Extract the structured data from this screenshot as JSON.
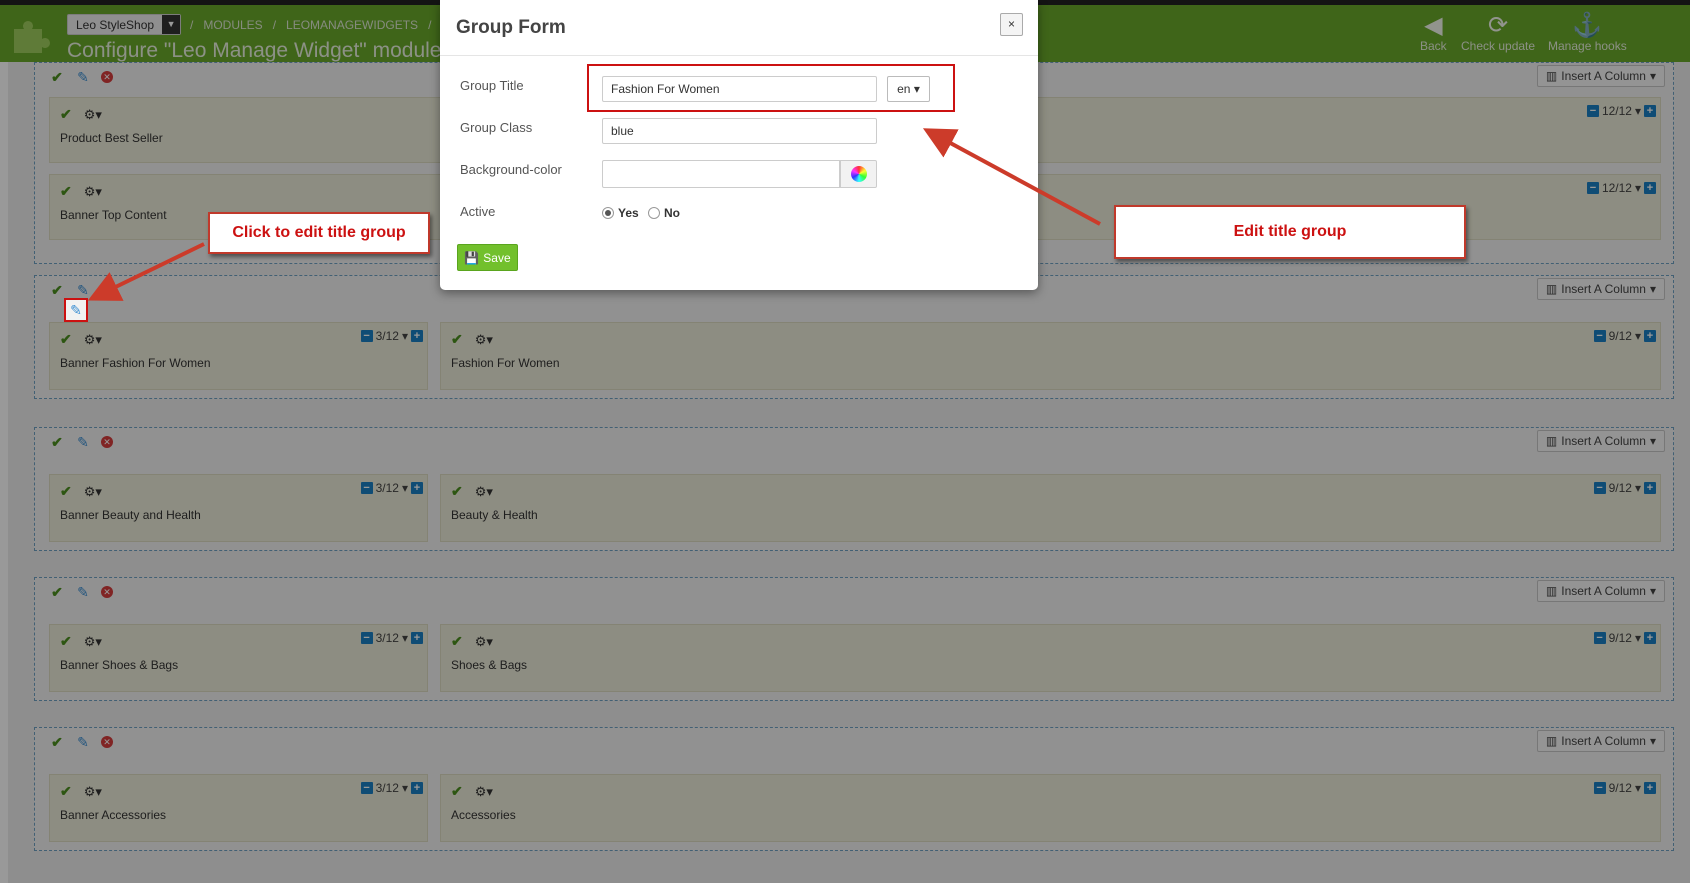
{
  "topbar": {
    "shop_name": "Leo StyleShop",
    "breadcrumb": [
      "MODULES",
      "LEOMANAGEWIDGETS"
    ],
    "breadcrumb_sep": "/",
    "title": "Configure \"Leo Manage Widget\" module",
    "buttons": [
      {
        "label": "Back",
        "icon": "back-icon"
      },
      {
        "label": "Check update",
        "icon": "refresh-icon"
      },
      {
        "label": "Manage hooks",
        "icon": "anchor-icon"
      }
    ]
  },
  "insert_column_label": "Insert A Column",
  "groups": [
    {
      "columns": [
        {
          "title": "Product Best Seller",
          "width": "12/12"
        }
      ]
    },
    {
      "columns": [
        {
          "title": "Banner Top Content",
          "width": "12/12"
        }
      ]
    },
    {
      "columns": [
        {
          "title": "Banner Fashion For Women",
          "width": "3/12"
        },
        {
          "title": "Fashion For Women",
          "width": "9/12"
        }
      ]
    },
    {
      "columns": [
        {
          "title": "Banner Beauty and Health",
          "width": "3/12"
        },
        {
          "title": "Beauty & Health",
          "width": "9/12"
        }
      ]
    },
    {
      "columns": [
        {
          "title": "Banner Shoes & Bags",
          "width": "3/12"
        },
        {
          "title": "Shoes & Bags",
          "width": "9/12"
        }
      ]
    },
    {
      "columns": [
        {
          "title": "Banner Accessories",
          "width": "3/12"
        },
        {
          "title": "Accessories",
          "width": "9/12"
        }
      ]
    }
  ],
  "modal": {
    "title": "Group Form",
    "close": "×",
    "group_title_label": "Group Title",
    "group_title_value": "Fashion For Women",
    "lang": "en",
    "group_class_label": "Group Class",
    "group_class_value": "blue",
    "bg_color_label": "Background-color",
    "bg_color_value": "",
    "active_label": "Active",
    "yes": "Yes",
    "no": "No",
    "active_selected": "Yes",
    "save": "Save"
  },
  "callouts": {
    "left": "Click to edit title group",
    "right": "Edit title group"
  },
  "colors": {
    "topbar": "#6aa82a",
    "callout_text": "#cc1111",
    "save": "#72c02c"
  }
}
